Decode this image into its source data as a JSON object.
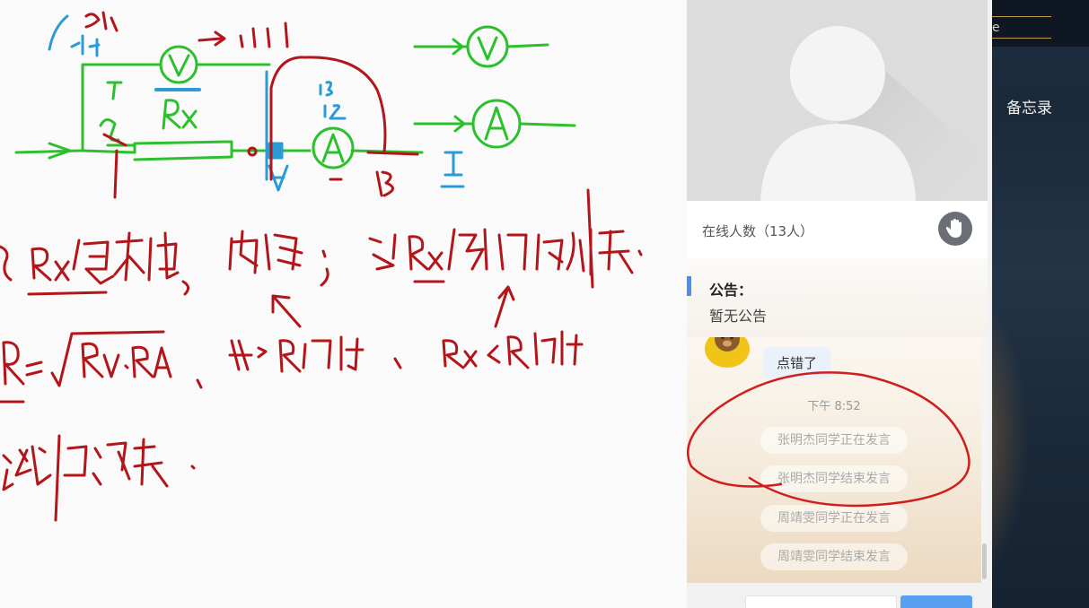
{
  "panel": {
    "online_count": "在线人数（13人）",
    "notice": {
      "title": "公告：",
      "body": "暂无公告"
    },
    "chat": {
      "messages": [
        {
          "text": "点错了"
        }
      ],
      "timestamp": "下午 8:52",
      "system_messages": [
        "张明杰同学正在发言",
        "张明杰同学结束发言",
        "周靖雯同学正在发言",
        "周靖雯同学结束发言"
      ]
    }
  },
  "right_bar": {
    "edge_glyph": "e",
    "memo_label": "备忘录"
  },
  "colors": {
    "annotation_red": "#d01d1d",
    "ink_green": "#2cc12c",
    "ink_blue": "#2a9bd6",
    "ink_darkred": "#b3161a",
    "notice_accent": "#4b8df0"
  },
  "icons": [
    "default-avatar-icon",
    "raise-hand-icon",
    "bear-avatar-icon",
    "emoji-icon"
  ]
}
